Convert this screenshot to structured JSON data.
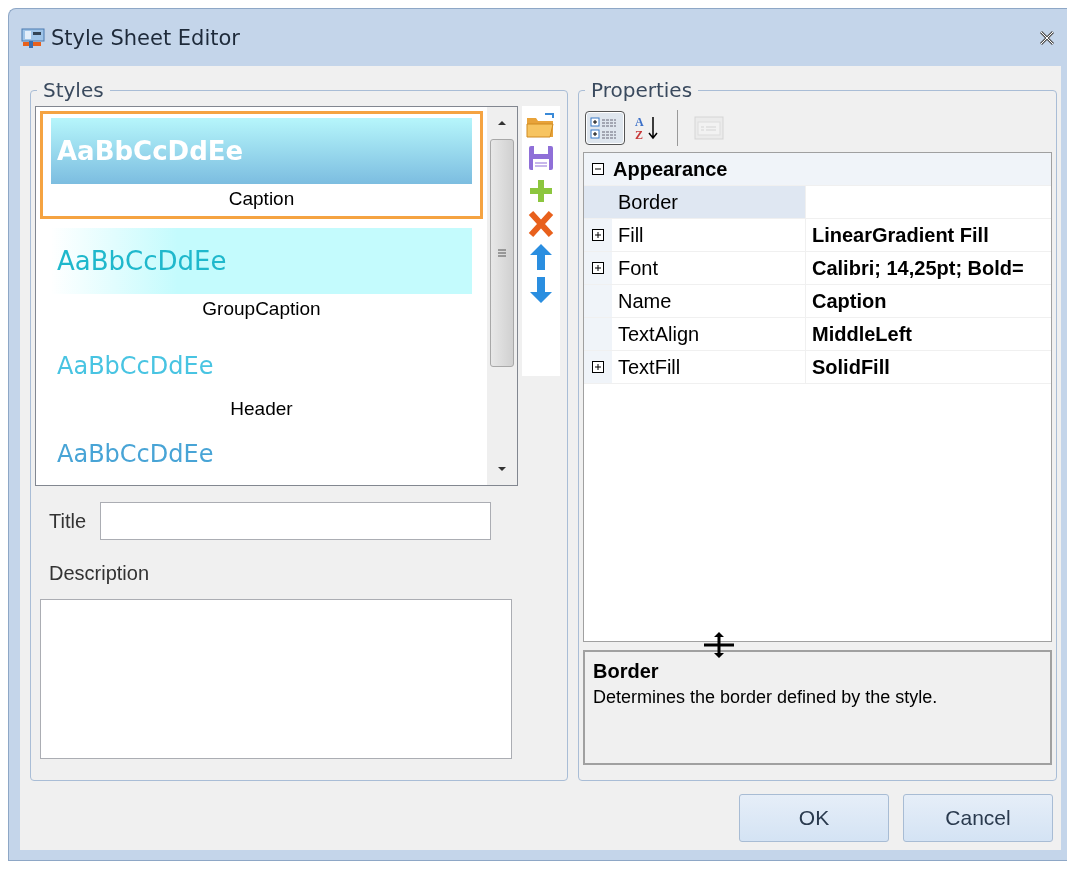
{
  "window": {
    "title": "Style Sheet Editor"
  },
  "styles": {
    "legend": "Styles",
    "items": [
      {
        "kind": "gradient",
        "preview": "AaBbCcDdEe",
        "name": "Caption",
        "selected": true
      },
      {
        "kind": "pale",
        "preview": "AaBbCcDdEe",
        "name": "GroupCaption",
        "selected": false
      },
      {
        "kind": "plain",
        "preview": "AaBbCcDdEe",
        "name": "Header",
        "selected": false
      },
      {
        "kind": "cut",
        "preview": "AaBbCcDdEe",
        "selected": false
      }
    ],
    "actions": [
      {
        "kind": "open"
      },
      {
        "kind": "save"
      },
      {
        "kind": "add"
      },
      {
        "kind": "delete"
      },
      {
        "kind": "up"
      },
      {
        "kind": "down"
      }
    ],
    "title_label": "Title",
    "description_label": "Description"
  },
  "properties": {
    "legend": "Properties",
    "toolbar": [
      {
        "kind": "categorized",
        "selected": true,
        "disabled": false
      },
      {
        "kind": "alphabetical",
        "selected": false,
        "disabled": false,
        "glyphs": [
          "A",
          "Z"
        ]
      },
      {
        "kind": "pages",
        "selected": false,
        "disabled": true
      }
    ],
    "category": {
      "name": "Appearance",
      "expanded": true
    },
    "rows": [
      {
        "name": "Border",
        "value": "",
        "expandable": false,
        "selected": true
      },
      {
        "name": "Fill",
        "value": "LinearGradient Fill",
        "expandable": true,
        "selected": false
      },
      {
        "name": "Font",
        "value": "Calibri; 14,25pt; Bold=",
        "expandable": true,
        "selected": false
      },
      {
        "name": "Name",
        "value": "Caption",
        "expandable": false,
        "selected": false
      },
      {
        "name": "TextAlign",
        "value": "MiddleLeft",
        "expandable": false,
        "selected": false
      },
      {
        "name": "TextFill",
        "value": "SolidFill",
        "expandable": true,
        "selected": false
      }
    ],
    "help": {
      "title": "Border",
      "text": "Determines the border defined by the style."
    }
  },
  "buttons": [
    "OK",
    "Cancel"
  ]
}
